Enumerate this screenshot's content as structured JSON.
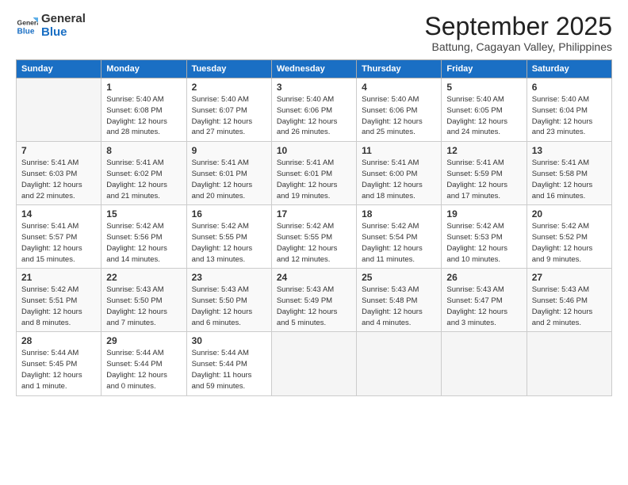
{
  "logo": {
    "line1": "General",
    "line2": "Blue"
  },
  "title": "September 2025",
  "subtitle": "Battung, Cagayan Valley, Philippines",
  "days_header": [
    "Sunday",
    "Monday",
    "Tuesday",
    "Wednesday",
    "Thursday",
    "Friday",
    "Saturday"
  ],
  "weeks": [
    [
      {
        "num": "",
        "info": ""
      },
      {
        "num": "1",
        "info": "Sunrise: 5:40 AM\nSunset: 6:08 PM\nDaylight: 12 hours\nand 28 minutes."
      },
      {
        "num": "2",
        "info": "Sunrise: 5:40 AM\nSunset: 6:07 PM\nDaylight: 12 hours\nand 27 minutes."
      },
      {
        "num": "3",
        "info": "Sunrise: 5:40 AM\nSunset: 6:06 PM\nDaylight: 12 hours\nand 26 minutes."
      },
      {
        "num": "4",
        "info": "Sunrise: 5:40 AM\nSunset: 6:06 PM\nDaylight: 12 hours\nand 25 minutes."
      },
      {
        "num": "5",
        "info": "Sunrise: 5:40 AM\nSunset: 6:05 PM\nDaylight: 12 hours\nand 24 minutes."
      },
      {
        "num": "6",
        "info": "Sunrise: 5:40 AM\nSunset: 6:04 PM\nDaylight: 12 hours\nand 23 minutes."
      }
    ],
    [
      {
        "num": "7",
        "info": "Sunrise: 5:41 AM\nSunset: 6:03 PM\nDaylight: 12 hours\nand 22 minutes."
      },
      {
        "num": "8",
        "info": "Sunrise: 5:41 AM\nSunset: 6:02 PM\nDaylight: 12 hours\nand 21 minutes."
      },
      {
        "num": "9",
        "info": "Sunrise: 5:41 AM\nSunset: 6:01 PM\nDaylight: 12 hours\nand 20 minutes."
      },
      {
        "num": "10",
        "info": "Sunrise: 5:41 AM\nSunset: 6:01 PM\nDaylight: 12 hours\nand 19 minutes."
      },
      {
        "num": "11",
        "info": "Sunrise: 5:41 AM\nSunset: 6:00 PM\nDaylight: 12 hours\nand 18 minutes."
      },
      {
        "num": "12",
        "info": "Sunrise: 5:41 AM\nSunset: 5:59 PM\nDaylight: 12 hours\nand 17 minutes."
      },
      {
        "num": "13",
        "info": "Sunrise: 5:41 AM\nSunset: 5:58 PM\nDaylight: 12 hours\nand 16 minutes."
      }
    ],
    [
      {
        "num": "14",
        "info": "Sunrise: 5:41 AM\nSunset: 5:57 PM\nDaylight: 12 hours\nand 15 minutes."
      },
      {
        "num": "15",
        "info": "Sunrise: 5:42 AM\nSunset: 5:56 PM\nDaylight: 12 hours\nand 14 minutes."
      },
      {
        "num": "16",
        "info": "Sunrise: 5:42 AM\nSunset: 5:55 PM\nDaylight: 12 hours\nand 13 minutes."
      },
      {
        "num": "17",
        "info": "Sunrise: 5:42 AM\nSunset: 5:55 PM\nDaylight: 12 hours\nand 12 minutes."
      },
      {
        "num": "18",
        "info": "Sunrise: 5:42 AM\nSunset: 5:54 PM\nDaylight: 12 hours\nand 11 minutes."
      },
      {
        "num": "19",
        "info": "Sunrise: 5:42 AM\nSunset: 5:53 PM\nDaylight: 12 hours\nand 10 minutes."
      },
      {
        "num": "20",
        "info": "Sunrise: 5:42 AM\nSunset: 5:52 PM\nDaylight: 12 hours\nand 9 minutes."
      }
    ],
    [
      {
        "num": "21",
        "info": "Sunrise: 5:42 AM\nSunset: 5:51 PM\nDaylight: 12 hours\nand 8 minutes."
      },
      {
        "num": "22",
        "info": "Sunrise: 5:43 AM\nSunset: 5:50 PM\nDaylight: 12 hours\nand 7 minutes."
      },
      {
        "num": "23",
        "info": "Sunrise: 5:43 AM\nSunset: 5:50 PM\nDaylight: 12 hours\nand 6 minutes."
      },
      {
        "num": "24",
        "info": "Sunrise: 5:43 AM\nSunset: 5:49 PM\nDaylight: 12 hours\nand 5 minutes."
      },
      {
        "num": "25",
        "info": "Sunrise: 5:43 AM\nSunset: 5:48 PM\nDaylight: 12 hours\nand 4 minutes."
      },
      {
        "num": "26",
        "info": "Sunrise: 5:43 AM\nSunset: 5:47 PM\nDaylight: 12 hours\nand 3 minutes."
      },
      {
        "num": "27",
        "info": "Sunrise: 5:43 AM\nSunset: 5:46 PM\nDaylight: 12 hours\nand 2 minutes."
      }
    ],
    [
      {
        "num": "28",
        "info": "Sunrise: 5:44 AM\nSunset: 5:45 PM\nDaylight: 12 hours\nand 1 minute."
      },
      {
        "num": "29",
        "info": "Sunrise: 5:44 AM\nSunset: 5:44 PM\nDaylight: 12 hours\nand 0 minutes."
      },
      {
        "num": "30",
        "info": "Sunrise: 5:44 AM\nSunset: 5:44 PM\nDaylight: 11 hours\nand 59 minutes."
      },
      {
        "num": "",
        "info": ""
      },
      {
        "num": "",
        "info": ""
      },
      {
        "num": "",
        "info": ""
      },
      {
        "num": "",
        "info": ""
      }
    ]
  ]
}
